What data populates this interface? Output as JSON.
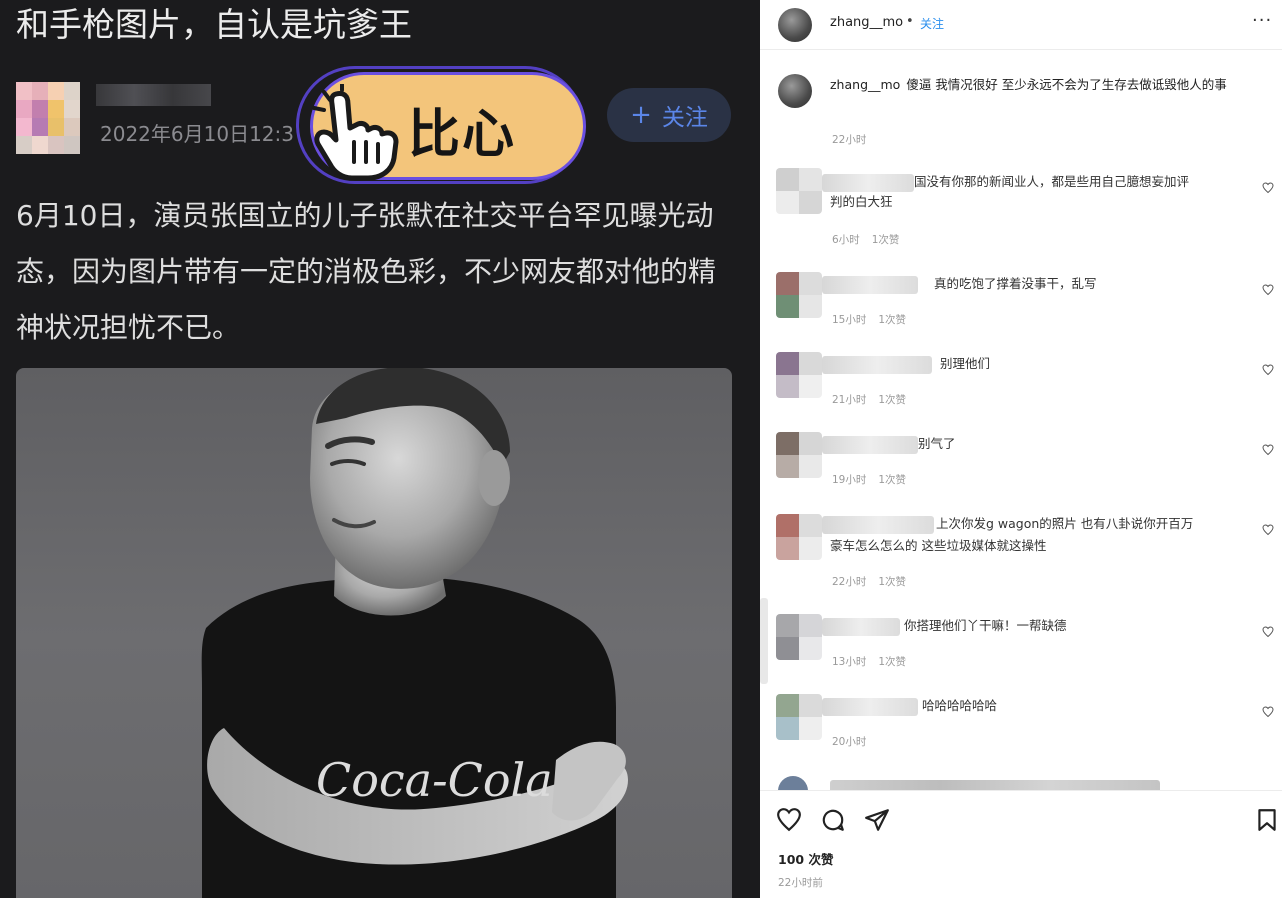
{
  "post": {
    "headline": "和手枪图片，自认是坑爹王",
    "date": "2022年6月10日12:3",
    "follow_label": "关注",
    "follow_icon": "plus-icon",
    "sticker_text": "比心",
    "body": "6月10日，演员张国立的儿子张默在社交平台罕见曝光动态，因为图片带有一定的消极色彩，不少网友都对他的精神状况担忧不已。",
    "shirt_brand": "Coca-Cola"
  },
  "instagram": {
    "username": "zhang__mo",
    "dot": "•",
    "follow_label": "关注",
    "more_icon": "more-icon",
    "caption": {
      "username": "zhang__mo",
      "text": "傻逼 我情况很好 至少永远不会为了生存去做诋毁他人的事",
      "time": "22小时"
    },
    "comments": [
      {
        "text": "国没有你那的新闻业人，都是些用自己臆想妄加评",
        "text2": "判的白大狂",
        "time": "6小时",
        "likes": "1次赞"
      },
      {
        "text": "真的吃饱了撑着没事干，乱写",
        "time": "15小时",
        "likes": "1次赞"
      },
      {
        "text": "别理他们",
        "time": "21小时",
        "likes": "1次赞"
      },
      {
        "text": "别气了",
        "time": "19小时",
        "likes": "1次赞"
      },
      {
        "text": "上次你发g wagon的照片 也有八卦说你开百万",
        "text2": "豪车怎么怎么的 这些垃圾媒体就这操性",
        "time": "22小时",
        "likes": "1次赞"
      },
      {
        "text": "你搭理他们丫干嘛！一帮缺德",
        "time": "13小时",
        "likes": "1次赞"
      },
      {
        "text": "哈哈哈哈哈哈",
        "time": "20小时"
      }
    ],
    "likes_total": "100 次赞",
    "post_time": "22小时前"
  },
  "colors": {
    "dark_bg": "#1b1b1d",
    "follow_blue": "#5b86e8",
    "sticker_fill": "#f3c57b",
    "sticker_outline": "#5a45d6",
    "ig_blue": "#2a8fee"
  }
}
